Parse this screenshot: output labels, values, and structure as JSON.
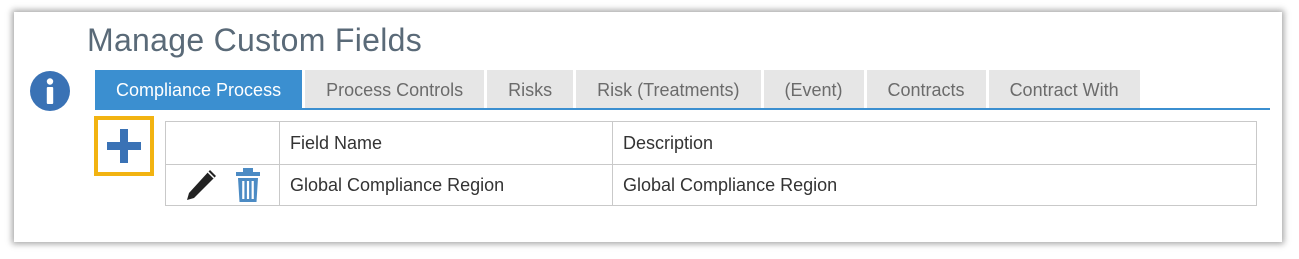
{
  "page": {
    "title": "Manage Custom Fields"
  },
  "icons": {
    "info": "info-circle-icon",
    "add": "plus-icon",
    "edit": "pencil-icon",
    "delete": "trash-icon"
  },
  "colors": {
    "accent": "#3b8fd0",
    "highlight": "#f2b311",
    "title": "#5a6a78"
  },
  "tabs": [
    {
      "label": "Compliance Process",
      "active": true
    },
    {
      "label": "Process Controls",
      "active": false
    },
    {
      "label": "Risks",
      "active": false
    },
    {
      "label": "Risk (Treatments)",
      "active": false
    },
    {
      "label": "(Event)",
      "active": false
    },
    {
      "label": "Contracts",
      "active": false
    },
    {
      "label": "Contract With",
      "active": false
    }
  ],
  "table": {
    "columns": [
      "",
      "Field Name",
      "Description"
    ],
    "rows": [
      {
        "field_name": "Global Compliance Region",
        "description": "Global Compliance Region"
      }
    ]
  }
}
